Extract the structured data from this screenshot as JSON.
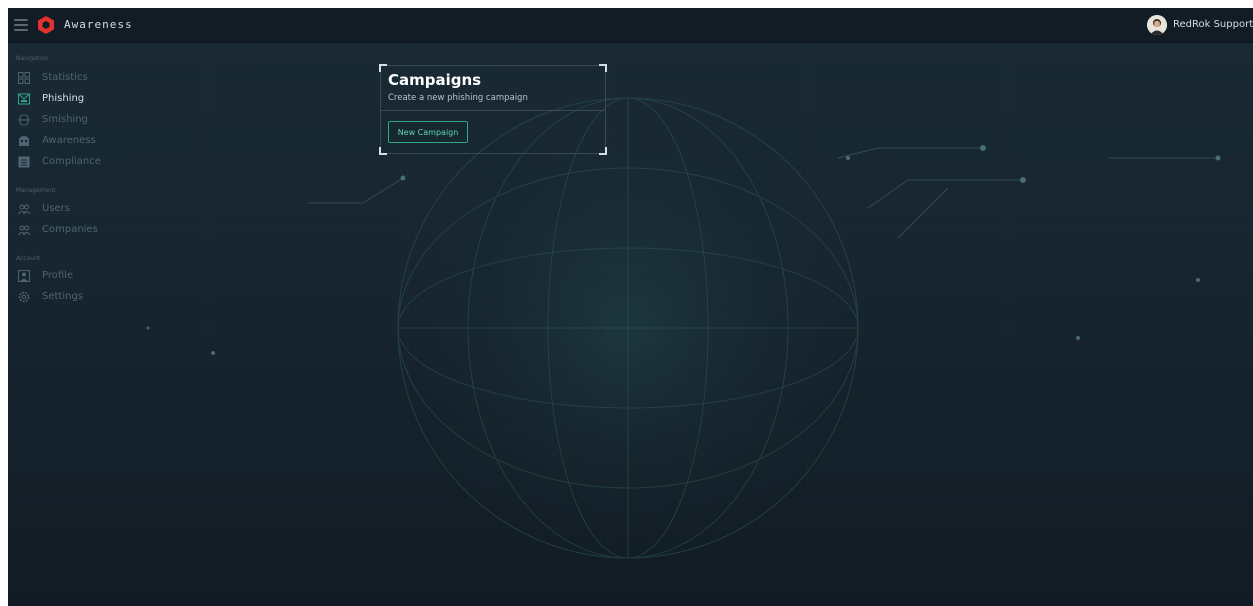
{
  "header": {
    "app_title": "Awareness",
    "user_name": "RedRok Support"
  },
  "sidebar": {
    "sections": [
      {
        "label": "Navigation",
        "items": [
          {
            "label": "Statistics",
            "icon": "chart-icon",
            "active": false
          },
          {
            "label": "Phishing",
            "icon": "phishing-icon",
            "active": true
          },
          {
            "label": "Smishing",
            "icon": "phone-icon",
            "active": false
          },
          {
            "label": "Awareness",
            "icon": "awareness-icon",
            "active": false
          },
          {
            "label": "Compliance",
            "icon": "compliance-icon",
            "active": false
          }
        ]
      },
      {
        "label": "Management",
        "items": [
          {
            "label": "Users",
            "icon": "users-icon",
            "active": false
          },
          {
            "label": "Companies",
            "icon": "companies-icon",
            "active": false
          }
        ]
      },
      {
        "label": "Account",
        "items": [
          {
            "label": "Profile",
            "icon": "profile-icon",
            "active": false
          },
          {
            "label": "Settings",
            "icon": "settings-icon",
            "active": false
          }
        ]
      }
    ]
  },
  "main": {
    "card": {
      "title": "Campaigns",
      "subtitle": "Create a new phishing campaign",
      "button_label": "New Campaign"
    }
  },
  "colors": {
    "accent": "#2fa58e",
    "logo_red": "#e0332f",
    "background": "#172631"
  }
}
